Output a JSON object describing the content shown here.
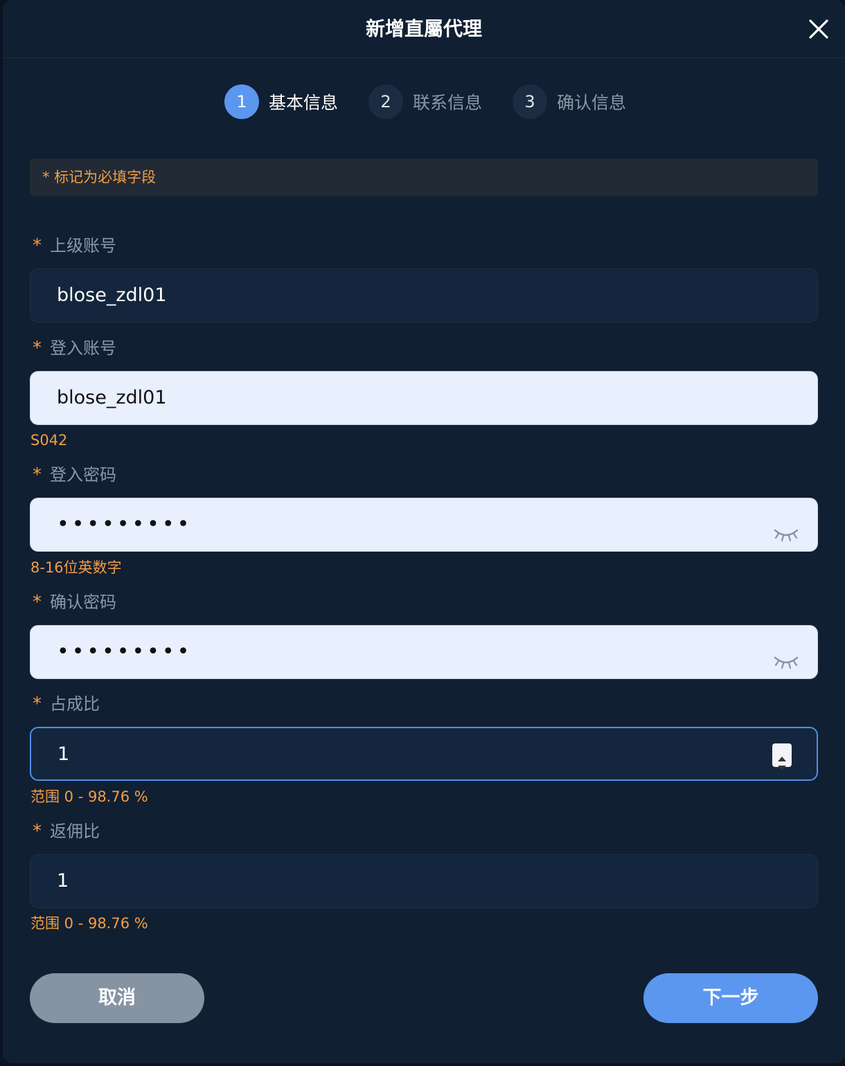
{
  "dialog": {
    "title": "新增直屬代理"
  },
  "steps": [
    {
      "number": "1",
      "label": "基本信息",
      "active": true
    },
    {
      "number": "2",
      "label": "联系信息",
      "active": false
    },
    {
      "number": "3",
      "label": "确认信息",
      "active": false
    }
  ],
  "notice": "* 标记为必填字段",
  "required_mark": "*",
  "fields": {
    "parent_account": {
      "label": "上级账号",
      "value": "blose_zdl01"
    },
    "login_account": {
      "label": "登入账号",
      "value": "blose_zdl01",
      "hint": "S042"
    },
    "login_password": {
      "label": "登入密码",
      "value": "•••••••••",
      "hint": "8-16位英数字"
    },
    "confirm_password": {
      "label": "确认密码",
      "value": "•••••••••"
    },
    "share_ratio": {
      "label": "占成比",
      "value": "1",
      "hint": "范围 0 - 98.76 %"
    },
    "rebate_ratio": {
      "label": "返佣比",
      "value": "1",
      "hint": "范围 0 - 98.76 %"
    }
  },
  "buttons": {
    "cancel": "取消",
    "next": "下一步"
  },
  "icons": {
    "close": "close-icon",
    "eye": "eye-closed-icon",
    "spinner": "number-spinner-icon"
  },
  "colors": {
    "accent": "#5b97ee",
    "warning": "#f39d43",
    "background": "#111f32"
  }
}
